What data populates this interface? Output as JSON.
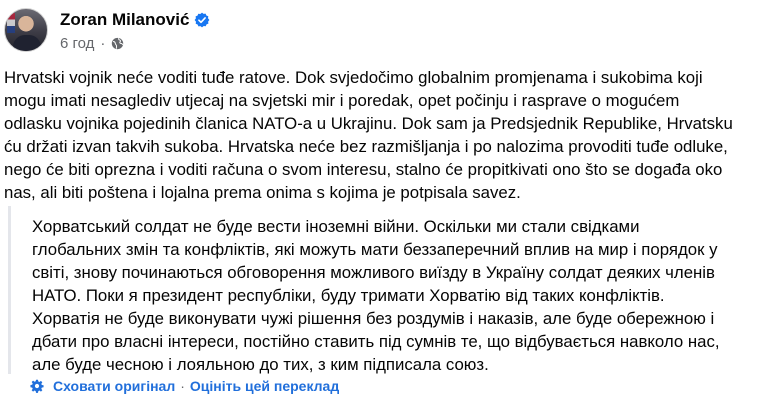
{
  "author": {
    "name": "Zoran Milanović",
    "avatar_icon": "profile-photo",
    "verified_icon": "verified-badge-icon",
    "verified_color": "#1877f2"
  },
  "meta": {
    "time": "6 год",
    "separator": "·",
    "audience_icon": "globe-icon"
  },
  "post": {
    "original_lines": [
      "Hrvatski vojnik neće voditi tuđe ratove. Dok svjedočimo globalnim promjenama i sukobima koji",
      "mogu imati nesaglediv utjecaj na svjetski mir i poredak, opet počinju i rasprave o mogućem",
      "odlasku vojnika pojedinih članica NATO-a u Ukrajinu. Dok sam ja Predsjednik Republike, Hrvatsku",
      "ću držati izvan takvih sukoba. Hrvatska neće bez razmišljanja i po nalozima provoditi tuđe odluke,",
      "nego će biti oprezna i voditi računa o svom interesu, stalno će propitkivati ono što se događa oko",
      "nas, ali biti poštena i lojalna prema onima s kojima je potpisala savez."
    ],
    "translation_lines": [
      "Хорватський солдат не буде вести іноземні війни. Оскільки ми стали свідками",
      "глобальних змін та конфліктів, які можуть мати беззаперечний вплив на мир і порядок у",
      "світі, знову починаються обговорення можливого виїзду в Україну солдат деяких членів",
      "НАТО. Поки я президент республіки, буду тримати Хорватію від таких конфліктів.",
      "Хорватія не буде виконувати чужі рішення без роздумів і наказів, але буде обережною і",
      "дбати про власні інтереси, постійно ставить під сумнів те, що відбувається навколо нас,",
      "але буде чесною і лояльною до тих, з ким підписала союз."
    ]
  },
  "translation_actions": {
    "settings_icon": "gear-icon",
    "hide_original_label": "Сховати оригінал",
    "separator": "·",
    "rate_translation_label": "Оцініть цей переклад",
    "link_color": "#216fdb"
  }
}
